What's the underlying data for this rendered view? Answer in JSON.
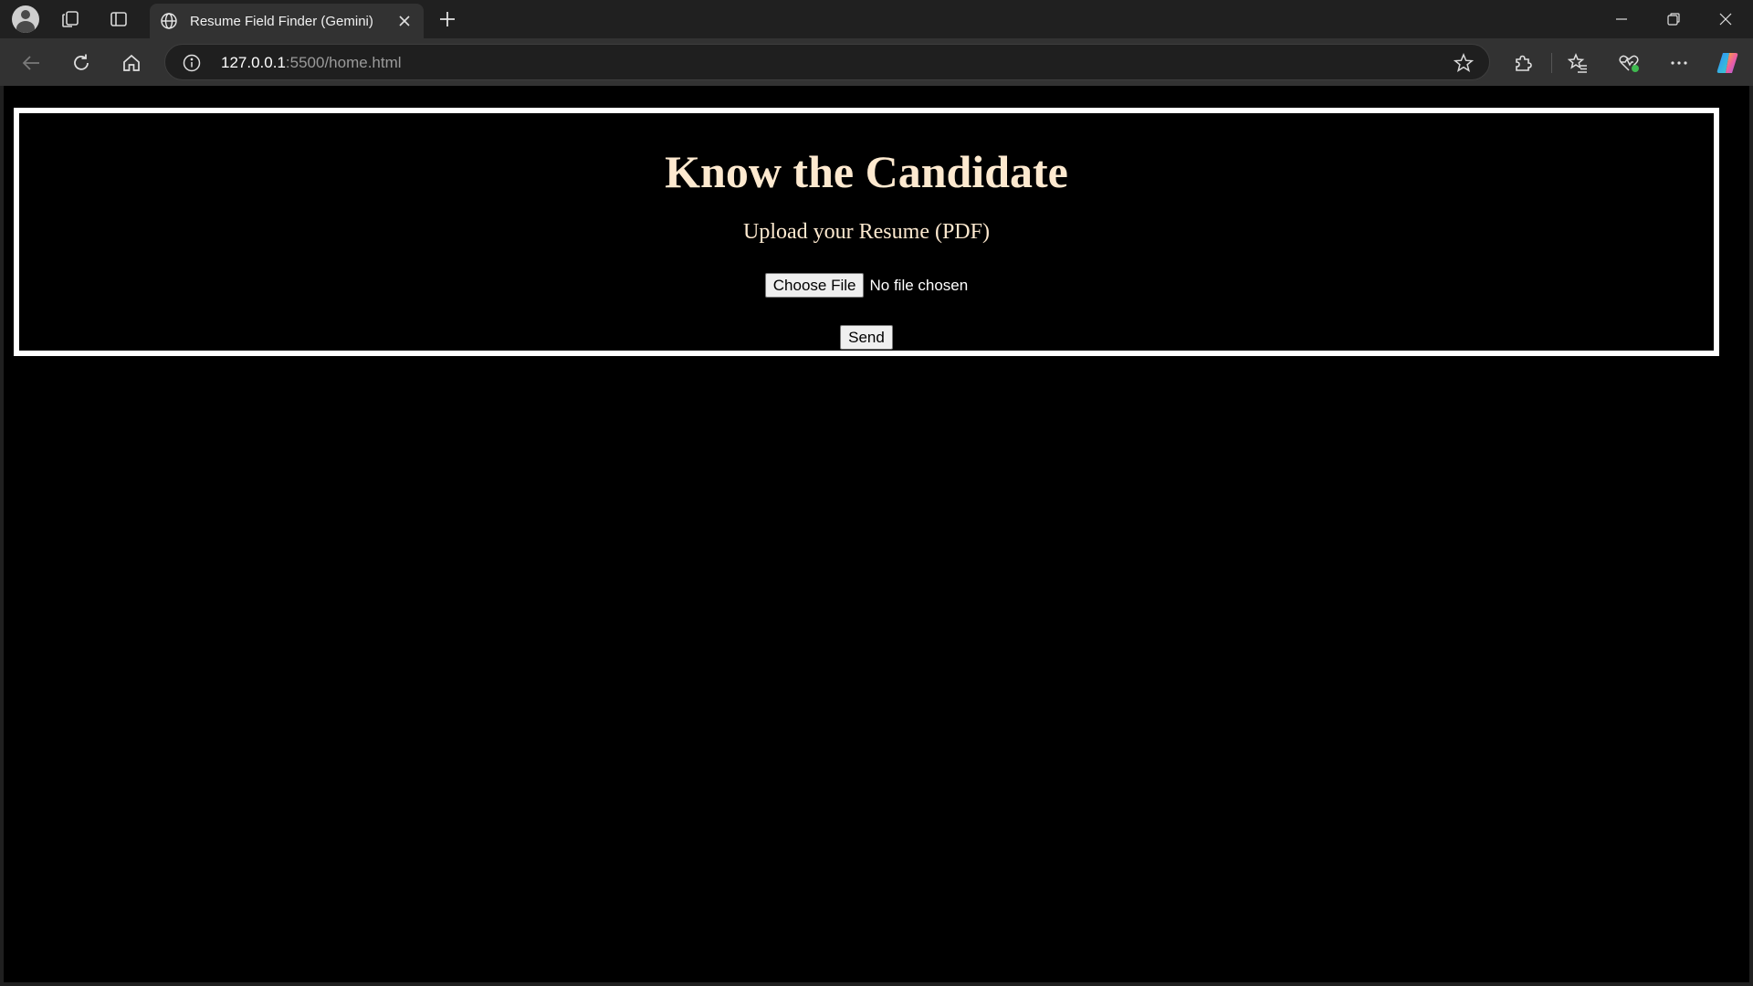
{
  "browser": {
    "tab": {
      "title": "Resume Field Finder (Gemini)"
    },
    "address": {
      "host": "127.0.0.1",
      "path": ":5500/home.html"
    }
  },
  "page": {
    "heading": "Know the Candidate",
    "subheading": "Upload your Resume (PDF)",
    "file_input": {
      "button_label": "Choose File",
      "status": "No file chosen"
    },
    "send_label": "Send"
  },
  "colors": {
    "page_background": "#000000",
    "heading_text": "#fde9cf",
    "card_border": "#ffffff"
  }
}
